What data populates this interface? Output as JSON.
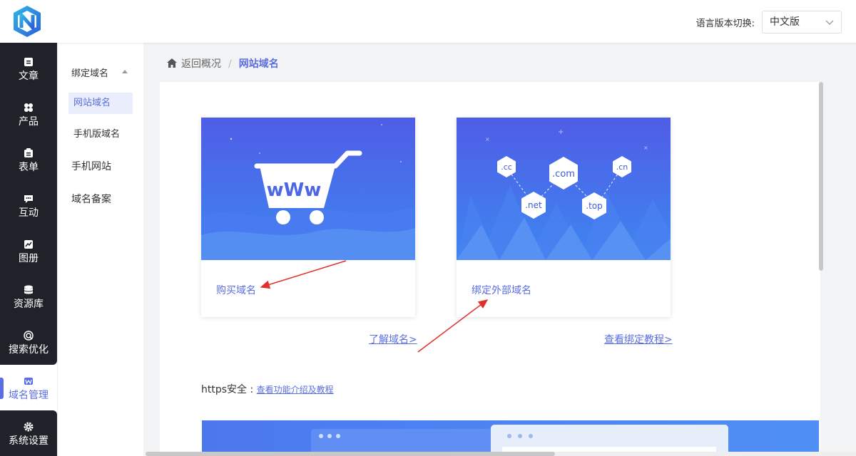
{
  "header": {
    "lang_label": "语言版本切换:",
    "lang_value": "中文版"
  },
  "sidebar": {
    "items": [
      {
        "label": "文章",
        "icon": "article-icon"
      },
      {
        "label": "产品",
        "icon": "product-icon"
      },
      {
        "label": "表单",
        "icon": "form-icon"
      },
      {
        "label": "互动",
        "icon": "chat-icon"
      },
      {
        "label": "图册",
        "icon": "album-icon"
      },
      {
        "label": "资源库",
        "icon": "database-icon"
      },
      {
        "label": "搜索优化",
        "icon": "seo-icon"
      },
      {
        "label": "域名管理",
        "icon": "domain-icon"
      },
      {
        "label": "系统设置",
        "icon": "gear-icon"
      }
    ],
    "active_index": 7
  },
  "subnav": {
    "group": "绑定域名",
    "items": [
      "网站域名",
      "手机版域名"
    ],
    "selected": "网站域名",
    "others": [
      "手机网站",
      "域名备案"
    ]
  },
  "breadcrumb": {
    "back": "返回概况",
    "current": "网站域名"
  },
  "cards": [
    {
      "title": "购买域名",
      "link": "了解域名>"
    },
    {
      "title": "绑定外部域名",
      "link": "查看绑定教程>"
    }
  ],
  "domain_tags": [
    ".cc",
    ".com",
    ".cn",
    ".net",
    ".top"
  ],
  "cart_text": "wWw",
  "https": {
    "label": "https安全 : ",
    "link": "查看功能介绍及教程"
  },
  "colors": {
    "accent": "#5b6ee1",
    "sidebar_bg": "#1f2329",
    "annotation": "#e0302a"
  }
}
